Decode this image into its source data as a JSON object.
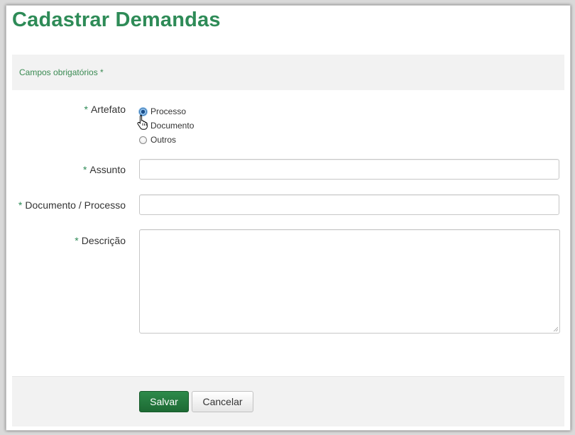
{
  "page": {
    "title": "Cadastrar Demandas"
  },
  "required_notice": "Campos obrigatórios *",
  "form": {
    "required_mark": "*",
    "artefato": {
      "label": "Artefato",
      "options": [
        {
          "label": "Processo",
          "selected": true
        },
        {
          "label": "Documento",
          "selected": false
        },
        {
          "label": "Outros",
          "selected": false
        }
      ]
    },
    "assunto": {
      "label": "Assunto",
      "value": ""
    },
    "documento_processo": {
      "label": "Documento / Processo",
      "value": ""
    },
    "descricao": {
      "label": "Descrição",
      "value": ""
    }
  },
  "buttons": {
    "save": "Salvar",
    "cancel": "Cancelar"
  },
  "icons": {
    "cursor": "hand-pointer-icon",
    "resize": "resize-grip-icon"
  },
  "colors": {
    "title": "#2e8b57",
    "primary_button": "#1f7a3c",
    "required_mark": "#2e8b57"
  }
}
